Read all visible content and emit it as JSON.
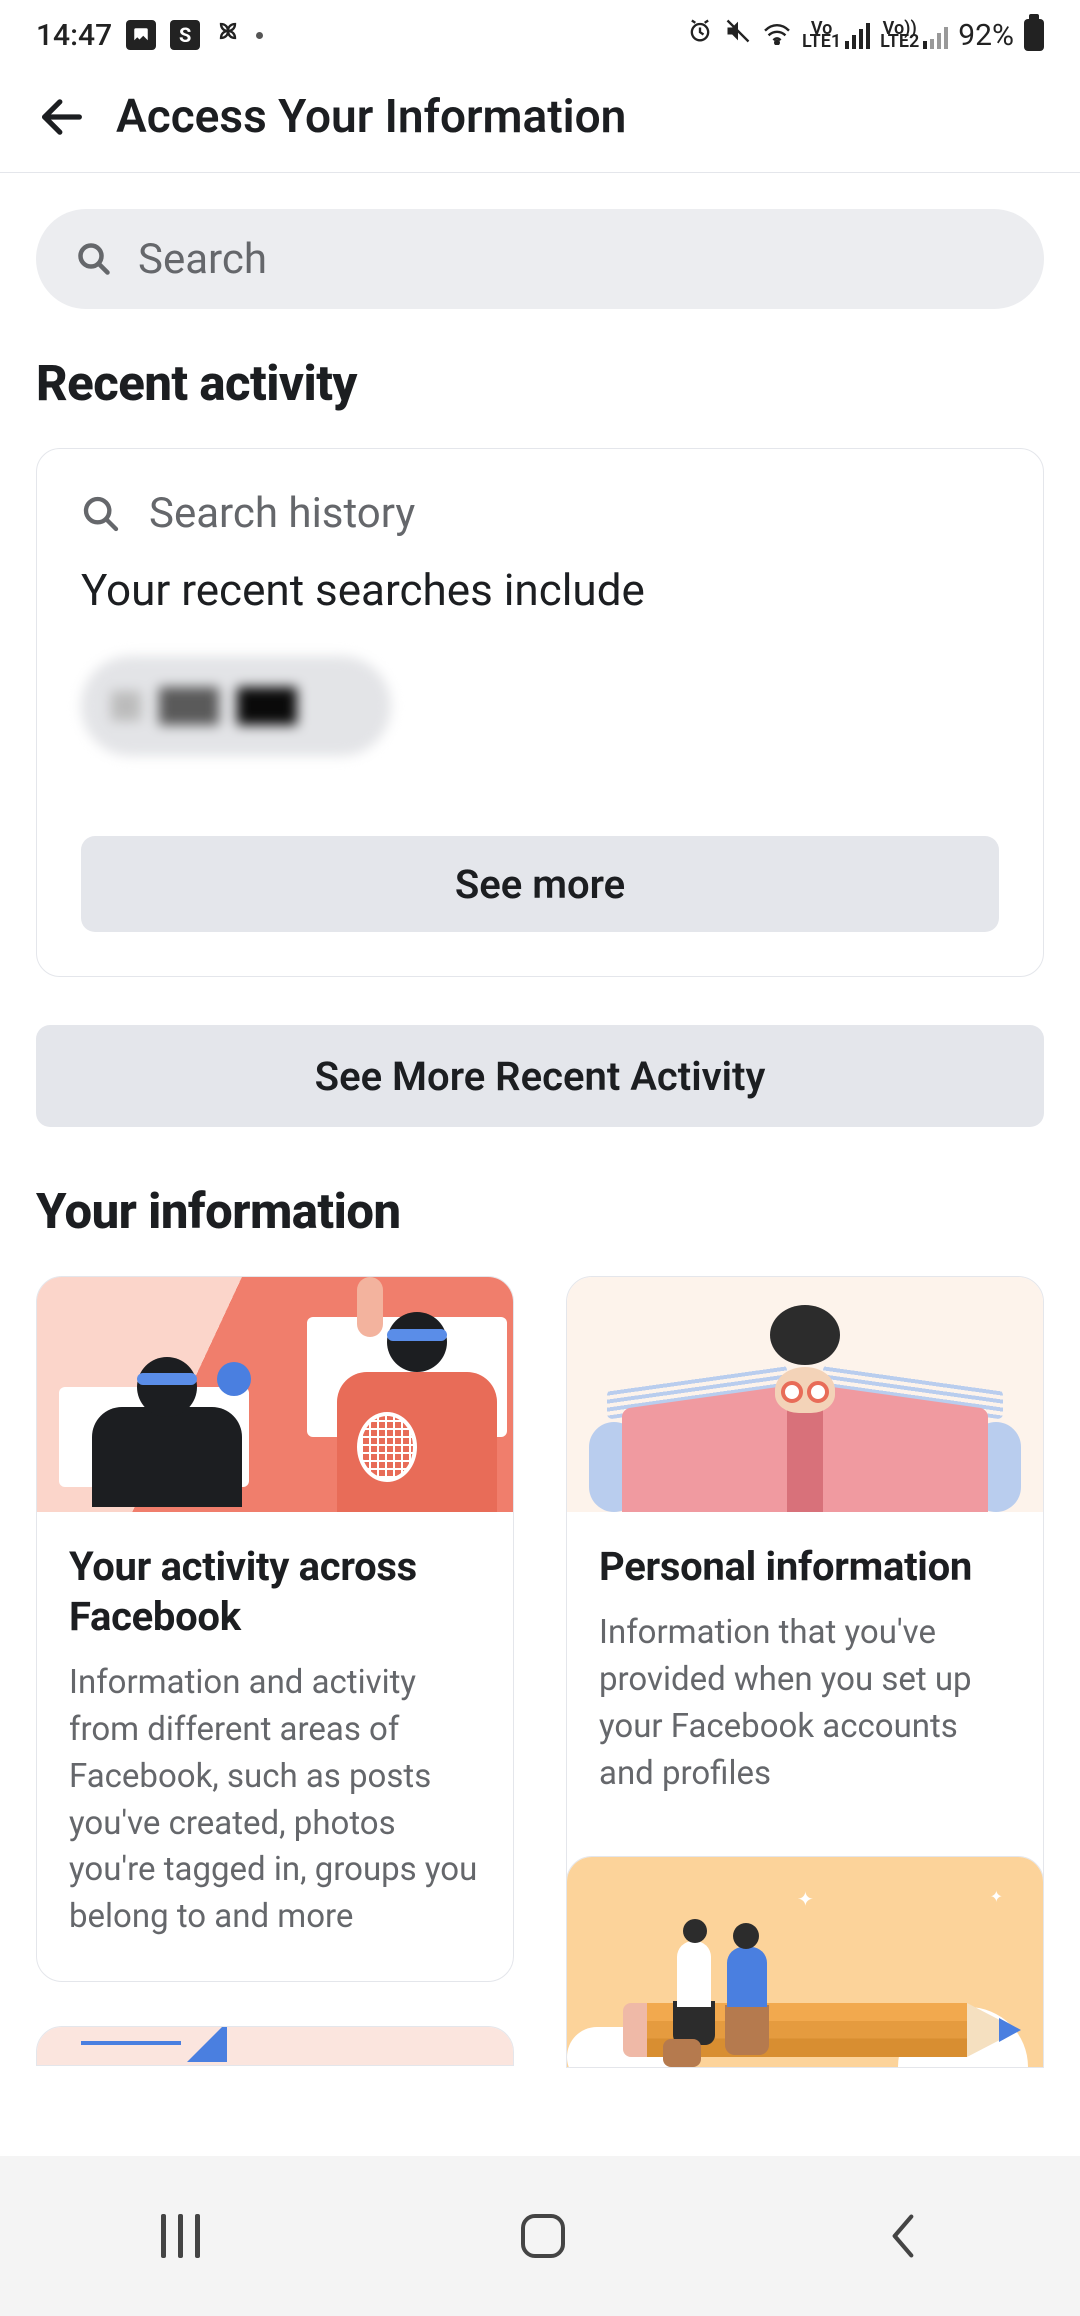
{
  "status": {
    "time": "14:47",
    "battery_pct": "92%",
    "lte1": "LTE1",
    "lte2": "LTE2",
    "vo1": "Vo",
    "vo2": "Vo))"
  },
  "header": {
    "title": "Access Your Information"
  },
  "search": {
    "placeholder": "Search"
  },
  "recent": {
    "heading": "Recent activity",
    "card_title": "Search history",
    "card_subtitle": "Your recent searches include",
    "see_more": "See more",
    "see_more_activity": "See More Recent Activity"
  },
  "info": {
    "heading": "Your information",
    "cards": [
      {
        "title": "Your activity across Facebook",
        "desc": "Information and activity from different areas of Facebook, such as posts you've created, photos you're tagged in, groups you belong to and more"
      },
      {
        "title": "Personal information",
        "desc": "Information that you've provided when you set up your Facebook accounts and profiles"
      }
    ]
  }
}
